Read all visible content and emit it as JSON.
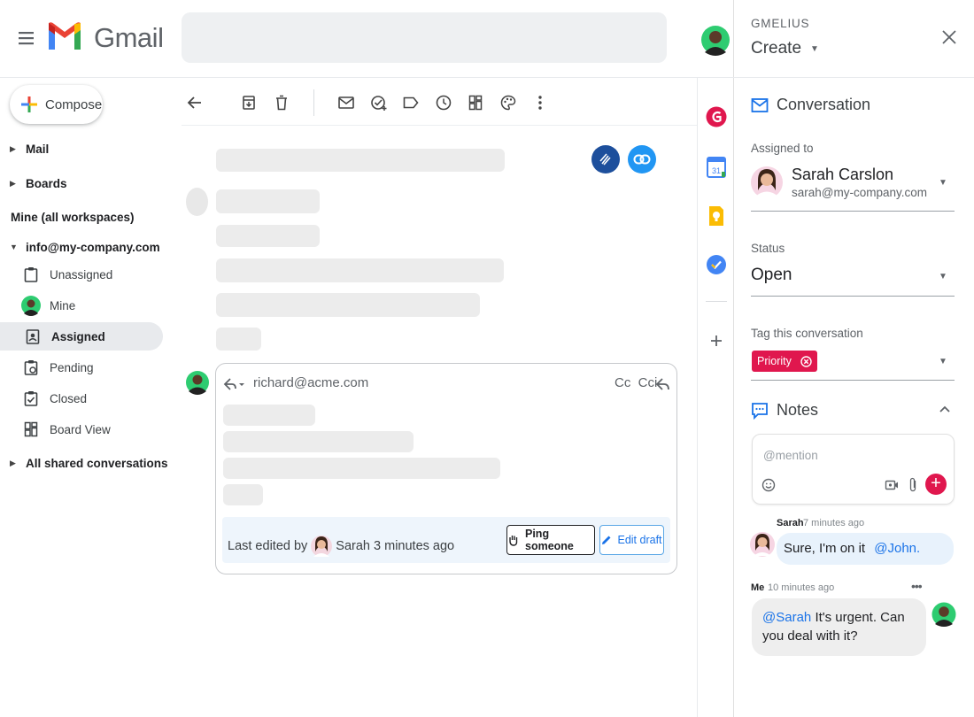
{
  "gmail": {
    "wordmark": "Gmail",
    "compose_label": "Compose"
  },
  "nav": {
    "mail": "Mail",
    "boards": "Boards",
    "mine_all": "Mine (all workspaces)",
    "account": "info@my-company.com",
    "items": [
      {
        "label": "Unassigned",
        "icon": "clipboard-icon"
      },
      {
        "label": "Mine",
        "icon": "avatar"
      },
      {
        "label": "Assigned",
        "icon": "assigned-icon",
        "selected": true
      },
      {
        "label": "Pending",
        "icon": "pending-icon"
      },
      {
        "label": "Closed",
        "icon": "closed-icon"
      },
      {
        "label": "Board View",
        "icon": "board-icon"
      }
    ],
    "shared": "All shared conversations"
  },
  "reply": {
    "to": "richard@acme.com",
    "cc_bcc": "Cc  Cci",
    "last_edited_prefix": "Last edited by",
    "last_edited_suffix": "Sarah 3 minutes ago",
    "ping_label": "Ping someone",
    "edit_label": "Edit draft"
  },
  "panel": {
    "brand": "GMELIUS",
    "create_label": "Create",
    "conversation_title": "Conversation",
    "assigned_label": "Assigned to",
    "assignee_name": "Sarah Carslon",
    "assignee_email": "sarah@my-company.com",
    "status_label": "Status",
    "status_value": "Open",
    "tag_label": "Tag this conversation",
    "tag_value": "Priority",
    "notes_title": "Notes",
    "note_placeholder": "@mention",
    "comments": [
      {
        "author": "Sarah",
        "time": "7 minutes ago",
        "text": "Sure, I'm on it",
        "mention": "@John."
      },
      {
        "author": "Me",
        "time": "10 minutes ago",
        "mention": "@Sarah",
        "text": "It's urgent. Can you deal with it?"
      }
    ]
  },
  "colors": {
    "brand_red": "#e0174e",
    "link_blue": "#1a73e8",
    "selected_nav": "#e8eaed"
  }
}
